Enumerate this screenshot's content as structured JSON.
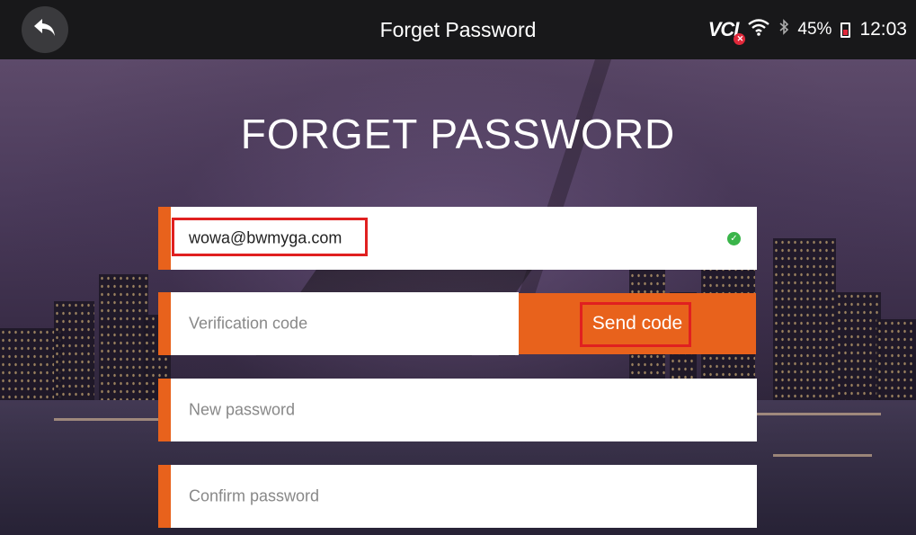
{
  "topbar": {
    "title": "Forget Password",
    "vci_label": "VCI",
    "battery": "45%",
    "time": "12:03",
    "icons": [
      "back-arrow-icon",
      "vci-error-icon",
      "wifi-icon",
      "bluetooth-icon",
      "battery-icon"
    ]
  },
  "form": {
    "heading": "FORGET PASSWORD",
    "email": {
      "value": "wowa@bwmyga.com",
      "valid": true
    },
    "verification": {
      "placeholder": "Verification code"
    },
    "send_code": "Send code",
    "new_password": {
      "placeholder": "New password"
    },
    "confirm_password": {
      "placeholder": "Confirm password"
    }
  },
  "colors": {
    "accent": "#e8621c",
    "topbar": "#18181a",
    "highlight": "#e02020",
    "valid": "#3ab54a"
  }
}
